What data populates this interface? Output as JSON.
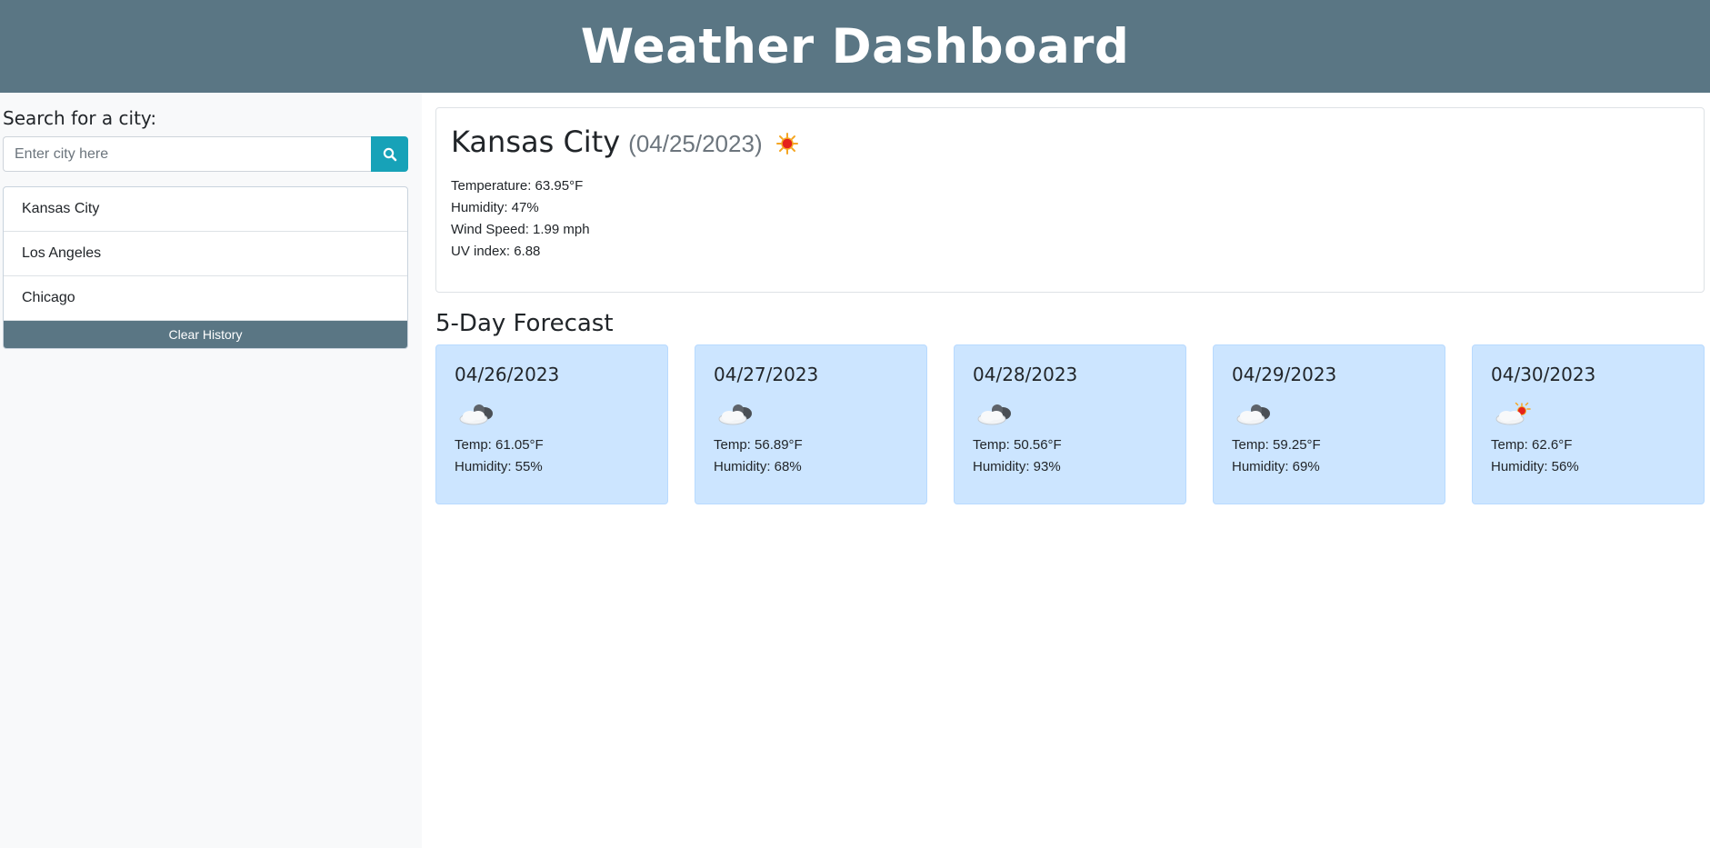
{
  "header": {
    "title": "Weather Dashboard"
  },
  "sidebar": {
    "search_title": "Search for a city:",
    "search_placeholder": "Enter city here",
    "search_button_icon": "search-icon",
    "history": [
      "Kansas City",
      "Los Angeles",
      "Chicago"
    ],
    "clear_label": "Clear History"
  },
  "current": {
    "city": "Kansas City",
    "date": "(04/25/2023)",
    "icon": "sun-icon",
    "temperature": "Temperature: 63.95°F",
    "humidity": "Humidity: 47%",
    "wind": "Wind Speed: 1.99 mph",
    "uv": "UV index: 6.88"
  },
  "forecast": {
    "title": "5-Day Forecast",
    "days": [
      {
        "date": "04/26/2023",
        "icon": "cloud-moon-icon",
        "temp": "Temp: 61.05°F",
        "humidity": "Humidity: 55%"
      },
      {
        "date": "04/27/2023",
        "icon": "cloud-moon-icon",
        "temp": "Temp: 56.89°F",
        "humidity": "Humidity: 68%"
      },
      {
        "date": "04/28/2023",
        "icon": "cloud-moon-icon",
        "temp": "Temp: 50.56°F",
        "humidity": "Humidity: 93%"
      },
      {
        "date": "04/29/2023",
        "icon": "cloud-moon-icon",
        "temp": "Temp: 59.25°F",
        "humidity": "Humidity: 69%"
      },
      {
        "date": "04/30/2023",
        "icon": "cloud-sun-icon",
        "temp": "Temp: 62.6°F",
        "humidity": "Humidity: 56%"
      }
    ]
  },
  "colors": {
    "header_bg": "#5a7684",
    "search_button": "#17a2b8",
    "forecast_card_bg": "#cce5ff"
  }
}
